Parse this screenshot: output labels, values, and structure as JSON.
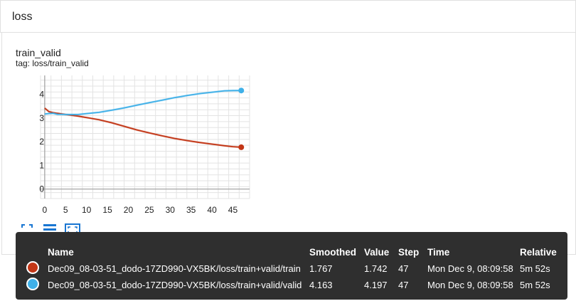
{
  "section": {
    "title": "loss"
  },
  "card": {
    "title": "train_valid",
    "tag": "tag: loss/train_valid"
  },
  "toolbar": {
    "fit_icon": "fullscreen-icon",
    "list_icon": "list-icon",
    "zoom_icon": "fit-domain-icon",
    "accent": "#1976d2"
  },
  "chart_data": {
    "type": "line",
    "xlim": [
      -1,
      49
    ],
    "ylim": [
      -0.4,
      4.8
    ],
    "xticks": [
      "0",
      "5",
      "10",
      "15",
      "20",
      "25",
      "30",
      "35",
      "40",
      "45"
    ],
    "yticks": [
      "0",
      "1",
      "2",
      "3",
      "4"
    ],
    "grid": true,
    "series": [
      {
        "name": "Dec09_08-03-51_dodo-17ZD990-VX5BK/loss/train+valid/train",
        "color": "#c23616",
        "x": [
          0,
          1,
          2,
          3,
          5,
          8,
          10,
          13,
          16,
          19,
          22,
          25,
          28,
          31,
          34,
          37,
          40,
          43,
          45,
          47
        ],
        "y": [
          3.42,
          3.27,
          3.23,
          3.2,
          3.15,
          3.08,
          3.02,
          2.93,
          2.8,
          2.65,
          2.5,
          2.37,
          2.25,
          2.14,
          2.05,
          1.97,
          1.9,
          1.83,
          1.79,
          1.767
        ]
      },
      {
        "name": "Dec09_08-03-51_dodo-17ZD990-VX5BK/loss/train+valid/valid",
        "color": "#3fb0e8",
        "x": [
          0,
          1,
          2,
          3,
          5,
          8,
          10,
          13,
          16,
          19,
          22,
          25,
          28,
          31,
          34,
          37,
          40,
          43,
          45,
          47
        ],
        "y": [
          3.17,
          3.19,
          3.2,
          3.16,
          3.15,
          3.15,
          3.19,
          3.24,
          3.33,
          3.43,
          3.54,
          3.65,
          3.75,
          3.86,
          3.95,
          4.03,
          4.09,
          4.15,
          4.16,
          4.163
        ]
      }
    ]
  },
  "tooltip": {
    "headers": [
      "Name",
      "Smoothed",
      "Value",
      "Step",
      "Time",
      "Relative"
    ],
    "rows": [
      {
        "color": "#c23616",
        "name": "Dec09_08-03-51_dodo-17ZD990-VX5BK/loss/train+valid/train",
        "smoothed": "1.767",
        "value": "1.742",
        "step": "47",
        "time": "Mon Dec 9, 08:09:58",
        "relative": "5m 52s"
      },
      {
        "color": "#3fb0e8",
        "name": "Dec09_08-03-51_dodo-17ZD990-VX5BK/loss/train+valid/valid",
        "smoothed": "4.163",
        "value": "4.197",
        "step": "47",
        "time": "Mon Dec 9, 08:09:58",
        "relative": "5m 52s"
      }
    ]
  }
}
